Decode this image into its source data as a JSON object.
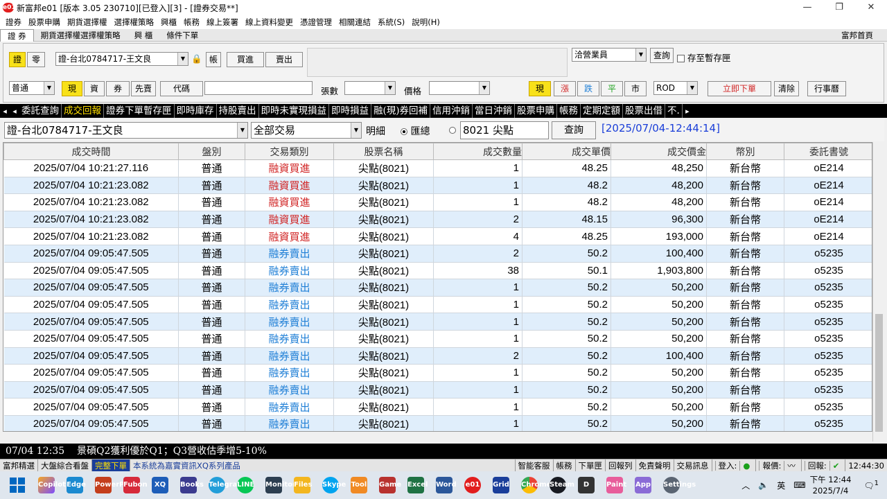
{
  "window": {
    "title": "新富邦e01 [版本 3.05 230710][已登入][3] - [證券交易**]",
    "logo": "e01",
    "controls": [
      "—",
      "❐",
      "✕"
    ]
  },
  "menu": [
    "證券",
    "股票申購",
    "期貨選擇權",
    "選擇權策略",
    "興櫃",
    "帳務",
    "線上簽署",
    "線上資料變更",
    "憑證管理",
    "相關連結",
    "系統(S)",
    "說明(H)"
  ],
  "subtabs": {
    "items": [
      "證 券",
      "期貨選擇權選擇權策略",
      "興 櫃",
      "條件下單"
    ],
    "home": "富邦首頁"
  },
  "order": {
    "mode_a": "證",
    "mode_b": "零",
    "account": "證-台北0784717-王文良",
    "lock_icon": "🔒",
    "acct_btn": "帳",
    "buy": "買進",
    "sell": "賣出",
    "agent": "洽營業員",
    "query": "查詢",
    "save_temp": "存至暫存匣",
    "type": "普通",
    "mode_now": "現",
    "mode_fin": "資",
    "mode_short": "券",
    "mode_first": "先賣",
    "code_label": "代碼",
    "qty_label": "張數",
    "price_label": "價格",
    "p_now": "現",
    "p_up": "漲",
    "p_down": "跌",
    "p_flat": "平",
    "p_mkt": "市",
    "tif": "ROD",
    "submit": "立即下單",
    "clear": "清除",
    "calendar": "行事曆"
  },
  "funcbar": {
    "left": "◂",
    "right": "▸",
    "tabs": [
      "委託查詢",
      "成交回報",
      "證券下單暫存匣",
      "即時庫存",
      "持股賣出",
      "即時未實現損益",
      "即時損益",
      "融(現)券回補",
      "信用沖銷",
      "當日沖銷",
      "股票申購",
      "帳務",
      "定期定額",
      "股票出借",
      "不."
    ],
    "active": 1
  },
  "query": {
    "account": "證-台北0784717-王文良",
    "trade_type": "全部交易",
    "detail": "明細",
    "summary": "匯總",
    "stock": "8021 尖點",
    "btn": "查詢",
    "timestamp": "[2025/07/04-12:44:14]"
  },
  "table": {
    "headers": [
      "成交時間",
      "盤別",
      "交易類別",
      "股票名稱",
      "成交數量",
      "成交單價",
      "成交價金",
      "幣別",
      "委託書號"
    ],
    "rows": [
      [
        "2025/07/04 10:21:27.116",
        "普通",
        "融資買進",
        "尖點(8021)",
        "1",
        "48.25",
        "48,250",
        "新台幣",
        "oE214"
      ],
      [
        "2025/07/04 10:21:23.082",
        "普通",
        "融資買進",
        "尖點(8021)",
        "1",
        "48.2",
        "48,200",
        "新台幣",
        "oE214"
      ],
      [
        "2025/07/04 10:21:23.082",
        "普通",
        "融資買進",
        "尖點(8021)",
        "1",
        "48.2",
        "48,200",
        "新台幣",
        "oE214"
      ],
      [
        "2025/07/04 10:21:23.082",
        "普通",
        "融資買進",
        "尖點(8021)",
        "2",
        "48.15",
        "96,300",
        "新台幣",
        "oE214"
      ],
      [
        "2025/07/04 10:21:23.082",
        "普通",
        "融資買進",
        "尖點(8021)",
        "4",
        "48.25",
        "193,000",
        "新台幣",
        "oE214"
      ],
      [
        "2025/07/04 09:05:47.505",
        "普通",
        "融券賣出",
        "尖點(8021)",
        "2",
        "50.2",
        "100,400",
        "新台幣",
        "o5235"
      ],
      [
        "2025/07/04 09:05:47.505",
        "普通",
        "融券賣出",
        "尖點(8021)",
        "38",
        "50.1",
        "1,903,800",
        "新台幣",
        "o5235"
      ],
      [
        "2025/07/04 09:05:47.505",
        "普通",
        "融券賣出",
        "尖點(8021)",
        "1",
        "50.2",
        "50,200",
        "新台幣",
        "o5235"
      ],
      [
        "2025/07/04 09:05:47.505",
        "普通",
        "融券賣出",
        "尖點(8021)",
        "1",
        "50.2",
        "50,200",
        "新台幣",
        "o5235"
      ],
      [
        "2025/07/04 09:05:47.505",
        "普通",
        "融券賣出",
        "尖點(8021)",
        "1",
        "50.2",
        "50,200",
        "新台幣",
        "o5235"
      ],
      [
        "2025/07/04 09:05:47.505",
        "普通",
        "融券賣出",
        "尖點(8021)",
        "1",
        "50.2",
        "50,200",
        "新台幣",
        "o5235"
      ],
      [
        "2025/07/04 09:05:47.505",
        "普通",
        "融券賣出",
        "尖點(8021)",
        "2",
        "50.2",
        "100,400",
        "新台幣",
        "o5235"
      ],
      [
        "2025/07/04 09:05:47.505",
        "普通",
        "融券賣出",
        "尖點(8021)",
        "1",
        "50.2",
        "50,200",
        "新台幣",
        "o5235"
      ],
      [
        "2025/07/04 09:05:47.505",
        "普通",
        "融券賣出",
        "尖點(8021)",
        "1",
        "50.2",
        "50,200",
        "新台幣",
        "o5235"
      ],
      [
        "2025/07/04 09:05:47.505",
        "普通",
        "融券賣出",
        "尖點(8021)",
        "1",
        "50.2",
        "50,200",
        "新台幣",
        "o5235"
      ],
      [
        "2025/07/04 09:05:47.505",
        "普通",
        "融券賣出",
        "尖點(8021)",
        "1",
        "50.2",
        "50,200",
        "新台幣",
        "o5235"
      ]
    ]
  },
  "news": {
    "time": "07/04 12:35",
    "headline": "景碩Q2獲利優於Q1；Q3營收估季增5-10%"
  },
  "status": {
    "tabs": [
      "富邦精選",
      "大盤綜合看盤",
      "完整下單"
    ],
    "message": "本系統為嘉實資訊XQ系列產品",
    "links": [
      "智能客服",
      "帳務",
      "下單匣",
      "回報列",
      "免責聲明",
      "交易訊息"
    ],
    "login": "登入:",
    "report": "報價:",
    "reply": "回報:",
    "time": "12:44:30"
  },
  "taskbar": {
    "apps": [
      "Copilot",
      "Edge",
      "PowerPoint",
      "Fubon",
      "XQ",
      "Books",
      "Telegram",
      "LINE",
      "Monitor",
      "Files",
      "Skype",
      "Tool",
      "Game",
      "Excel",
      "Word",
      "e01",
      "Grid",
      "Chrome",
      "Steam",
      "D",
      "Paint",
      "App",
      "Settings"
    ],
    "ime": "英",
    "time": "下午 12:44",
    "date": "2025/7/4",
    "notif": "1"
  },
  "colors": {
    "buy": "#d12626",
    "sell": "#1f7fd6",
    "accent": "#f8e11a",
    "active_tab": "#ffe000"
  }
}
